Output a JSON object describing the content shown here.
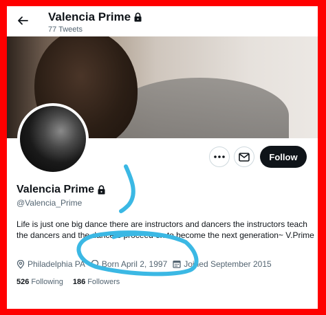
{
  "header": {
    "back_icon": "arrow-left-icon",
    "name": "Valencia Prime",
    "tweet_count": "77 Tweets",
    "lock_icon": "lock-icon"
  },
  "profile": {
    "name": "Valencia Prime",
    "handle": "@Valencia_Prime",
    "bio": "Life is just one big dance there are instructors and dancers the instructors teach the dancers and the dancers proceed on to become the next generation~ V.Prime",
    "location": "Philadelphia PA",
    "birthday": "Born April 2, 1997",
    "joined": "Joined September 2015",
    "following_count": "526",
    "following_label": "Following",
    "followers_count": "186",
    "followers_label": "Followers"
  },
  "actions": {
    "more_icon": "more-icon",
    "message_icon": "envelope-icon",
    "follow_label": "Follow"
  },
  "colors": {
    "border": "#ff0000",
    "annotation": "#3bb8e4",
    "text_primary": "#0f1419",
    "text_secondary": "#536471",
    "follow_bg": "#0f1419"
  }
}
